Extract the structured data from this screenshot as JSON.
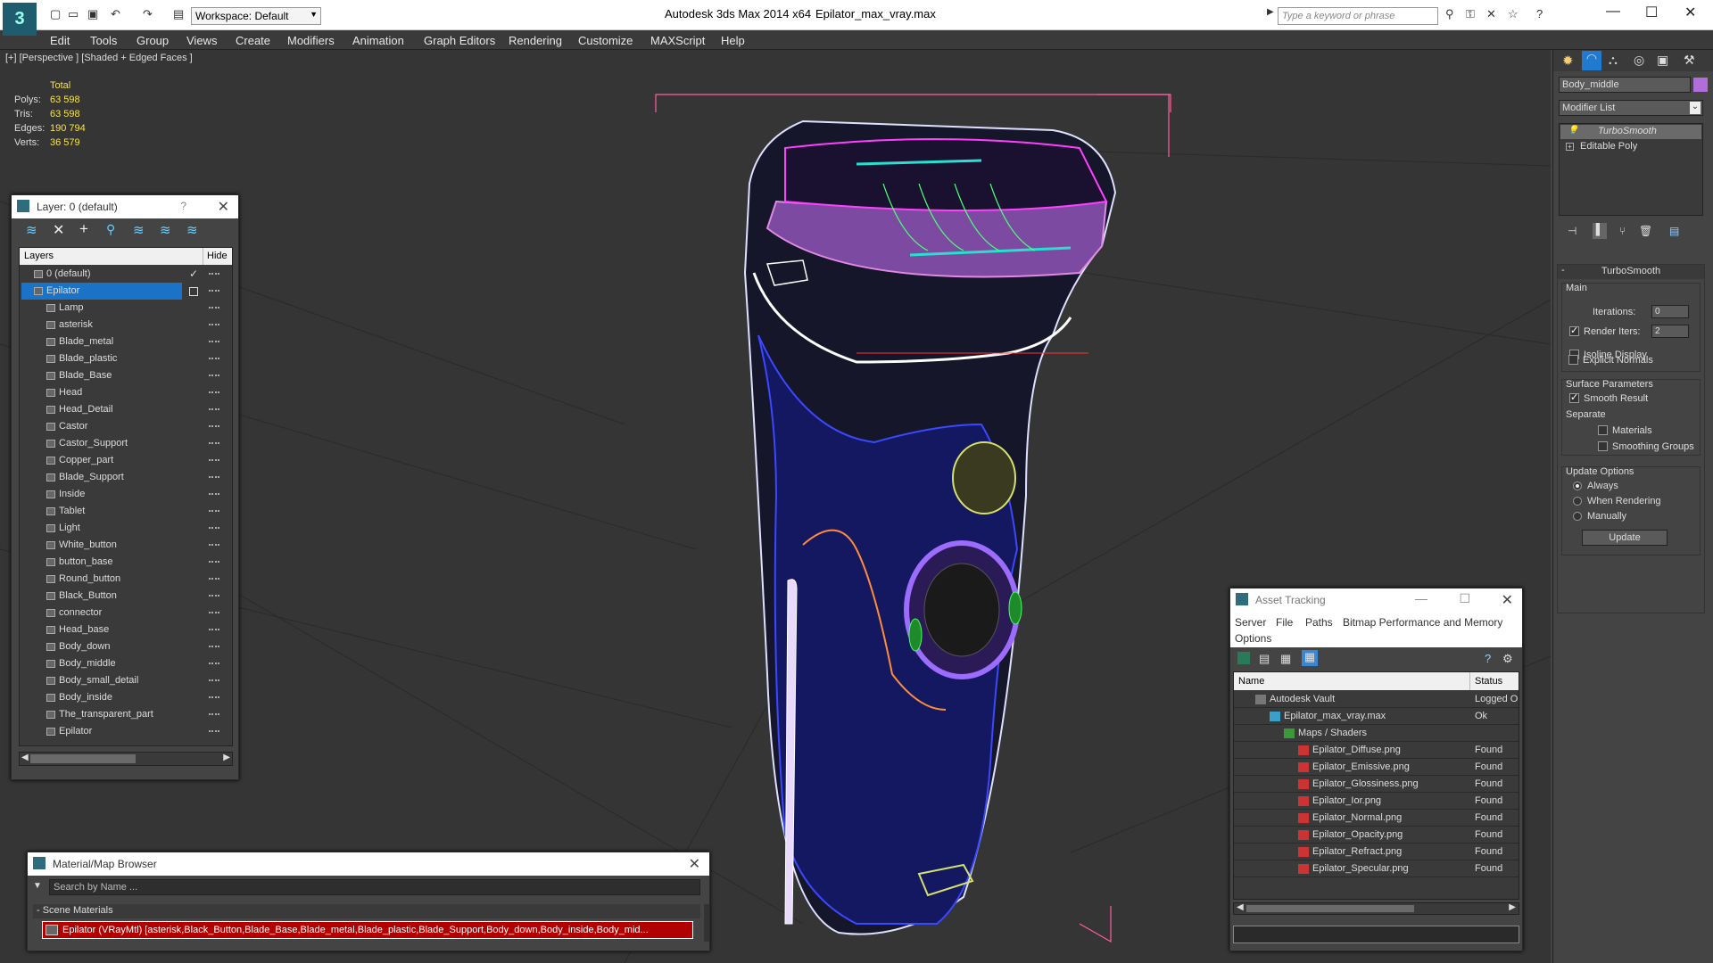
{
  "app": {
    "title": "Autodesk 3ds Max  2014 x64",
    "file": "Epilator_max_vray.max",
    "workspace": "Workspace: Default",
    "search_placeholder": "Type a keyword or phrase"
  },
  "menu": [
    "Edit",
    "Tools",
    "Group",
    "Views",
    "Create",
    "Modifiers",
    "Animation",
    "Graph Editors",
    "Rendering",
    "Customize",
    "MAXScript",
    "Help"
  ],
  "viewport": {
    "label": "[+] [Perspective ] [Shaded + Edged Faces ]",
    "stats": {
      "header": "Total",
      "rows": [
        {
          "k": "Polys:",
          "v": "63 598"
        },
        {
          "k": "Tris:",
          "v": "63 598"
        },
        {
          "k": "Edges:",
          "v": "190 794"
        },
        {
          "k": "Verts:",
          "v": "36 579"
        }
      ]
    }
  },
  "layer_panel": {
    "title": "Layer: 0 (default)",
    "help": "?",
    "col_layers": "Layers",
    "col_hide": "Hide",
    "items": [
      "0 (default)",
      "Epilator",
      "Lamp",
      "asterisk",
      "Blade_metal",
      "Blade_plastic",
      "Blade_Base",
      "Head",
      "Head_Detail",
      "Castor",
      "Castor_Support",
      "Copper_part",
      "Blade_Support",
      "Inside",
      "Tablet",
      "Light",
      "White_button",
      "button_base",
      "Round_button",
      "Black_Button",
      "connector",
      "Head_base",
      "Body_down",
      "Body_middle",
      "Body_small_detail",
      "Body_inside",
      "The_transparent_part",
      "Epilator"
    ]
  },
  "material_browser": {
    "title": "Material/Map Browser",
    "search_placeholder": "Search by Name ...",
    "section": "- Scene Materials",
    "item": "Epilator (VRayMtl) [asterisk,Black_Button,Blade_Base,Blade_metal,Blade_plastic,Blade_Support,Body_down,Body_inside,Body_mid..."
  },
  "asset_tracking": {
    "title": "Asset Tracking",
    "menu": [
      "Server",
      "File",
      "Paths",
      "Bitmap Performance and Memory"
    ],
    "menu2": "Options",
    "col_name": "Name",
    "col_status": "Status",
    "rows": [
      {
        "name": "Autodesk Vault",
        "status": "Logged O"
      },
      {
        "name": "Epilator_max_vray.max",
        "status": "Ok"
      },
      {
        "name": "Maps / Shaders",
        "status": ""
      },
      {
        "name": "Epilator_Diffuse.png",
        "status": "Found"
      },
      {
        "name": "Epilator_Emissive.png",
        "status": "Found"
      },
      {
        "name": "Epilator_Glossiness.png",
        "status": "Found"
      },
      {
        "name": "Epilator_Ior.png",
        "status": "Found"
      },
      {
        "name": "Epilator_Normal.png",
        "status": "Found"
      },
      {
        "name": "Epilator_Opacity.png",
        "status": "Found"
      },
      {
        "name": "Epilator_Refract.png",
        "status": "Found"
      },
      {
        "name": "Epilator_Specular.png",
        "status": "Found"
      }
    ]
  },
  "command_panel": {
    "object_name": "Body_middle",
    "modifier_list": "Modifier List",
    "stack": [
      "TurboSmooth",
      "Editable Poly"
    ],
    "rollout_title": "TurboSmooth",
    "main_label": "Main",
    "iterations_label": "Iterations:",
    "iterations_value": "0",
    "render_iters_label": "Render Iters:",
    "render_iters_value": "2",
    "isoline": "Isoline Display",
    "explicit_normals": "Explicit Normals",
    "surface_params": "Surface Parameters",
    "smooth_result": "Smooth Result",
    "separate": "Separate",
    "materials": "Materials",
    "smoothing_groups": "Smoothing Groups",
    "update_options": "Update Options",
    "always": "Always",
    "when_rendering": "When Rendering",
    "manually": "Manually",
    "update_btn": "Update"
  },
  "colors": {
    "accent": "#1a73c7",
    "stats": "#f7e54a",
    "viewport_bg": "#353535",
    "wire_magenta": "#e040e0",
    "wire_blue": "#3a48ff"
  }
}
